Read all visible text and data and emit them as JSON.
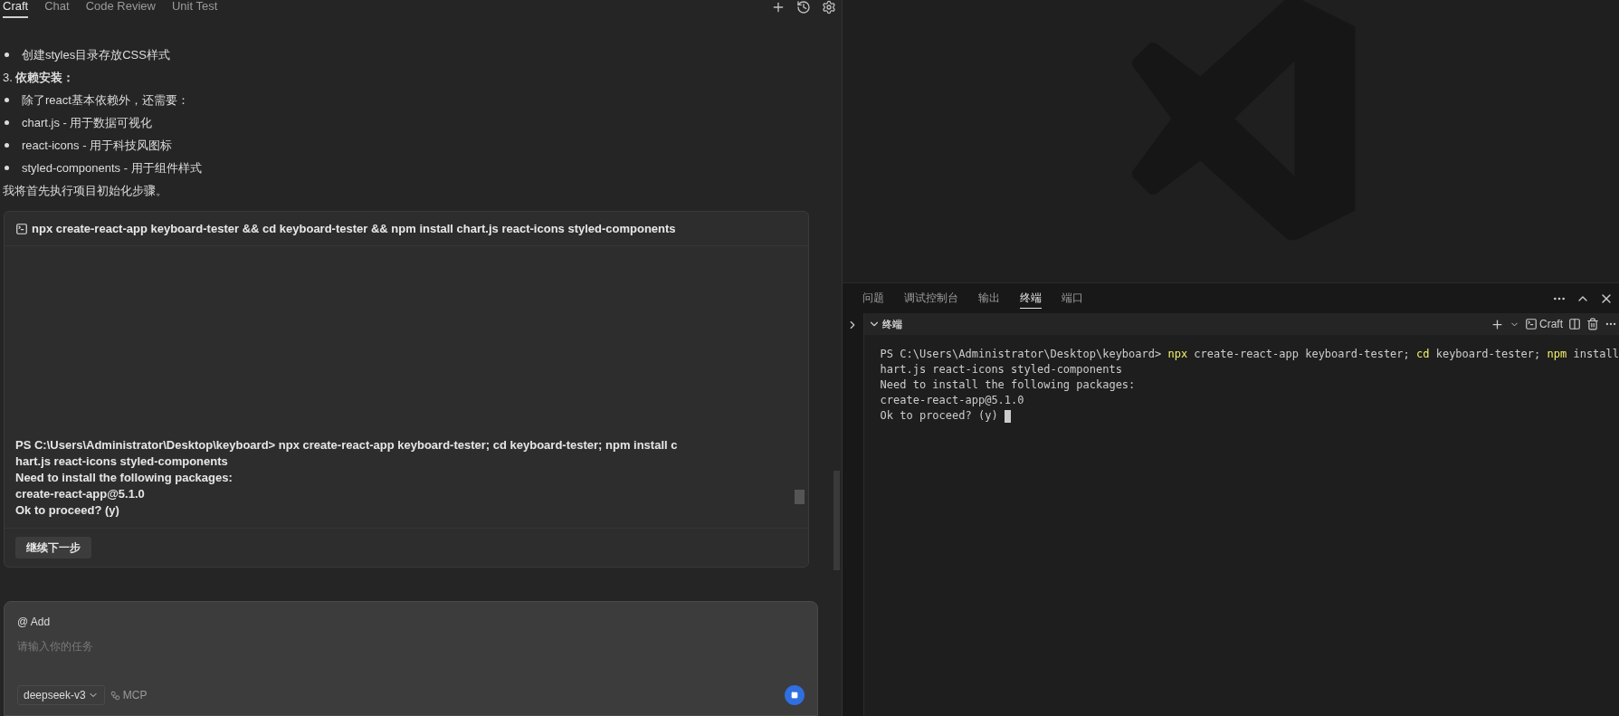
{
  "agent_panel": {
    "tabs": [
      {
        "label": "Craft",
        "selected": true
      },
      {
        "label": "Chat",
        "selected": false
      },
      {
        "label": "Code Review",
        "selected": false
      },
      {
        "label": "Unit Test",
        "selected": false
      }
    ],
    "messages": [
      {
        "kind": "bullet",
        "text": "创建styles目录存放CSS样式"
      },
      {
        "kind": "paragraph",
        "text": "3. **依赖安装：**"
      },
      {
        "kind": "bullet",
        "text": "除了react基本依赖外，还需要："
      },
      {
        "kind": "bullet",
        "text": "chart.js - 用于数据可视化"
      },
      {
        "kind": "bullet",
        "text": "react-icons - 用于科技风图标"
      },
      {
        "kind": "bullet",
        "text": "styled-components - 用于组件样式"
      },
      {
        "kind": "paragraph",
        "text": "我将首先执行项目初始化步骤。"
      }
    ],
    "command_card": {
      "command": "npx create-react-app keyboard-tester && cd keyboard-tester && npm install chart.js react-icons styled-components",
      "output": [
        "PS C:\\Users\\Administrator\\Desktop\\keyboard> npx create-react-app keyboard-tester; cd keyboard-tester; npm install c",
        "hart.js react-icons styled-components",
        "Need to install the following packages:",
        "create-react-app@5.1.0",
        "Ok to proceed? (y)"
      ],
      "button": "继续下一步"
    },
    "composer": {
      "mention": "@ Add",
      "placeholder": "请输入你的任务",
      "model": "deepseek-v3",
      "mcp": "MCP"
    }
  },
  "panel": {
    "tabs": [
      {
        "label": "问题",
        "selected": false
      },
      {
        "label": "调试控制台",
        "selected": false
      },
      {
        "label": "输出",
        "selected": false
      },
      {
        "label": "终端",
        "selected": true
      },
      {
        "label": "端口",
        "selected": false
      }
    ],
    "terminal": {
      "title": "终端",
      "profile": "Craft",
      "lines": [
        [
          {
            "text": "PS C:\\Users\\Administrator\\Desktop\\keyboard> ",
            "highlight": false
          },
          {
            "text": "npx",
            "highlight": true
          },
          {
            "text": " create-react-app keyboard-tester; ",
            "highlight": false
          },
          {
            "text": "cd",
            "highlight": true
          },
          {
            "text": " keyboard-tester; ",
            "highlight": false
          },
          {
            "text": "npm",
            "highlight": true
          },
          {
            "text": " install",
            "highlight": false
          }
        ],
        [
          {
            "text": "hart.js react-icons styled-components",
            "highlight": false
          }
        ],
        [
          {
            "text": "Need to install the following packages:",
            "highlight": false
          }
        ],
        [
          {
            "text": "create-react-app@5.1.0",
            "highlight": false
          }
        ],
        [
          {
            "text": "Ok to proceed? (y) ",
            "highlight": false
          }
        ]
      ]
    }
  }
}
